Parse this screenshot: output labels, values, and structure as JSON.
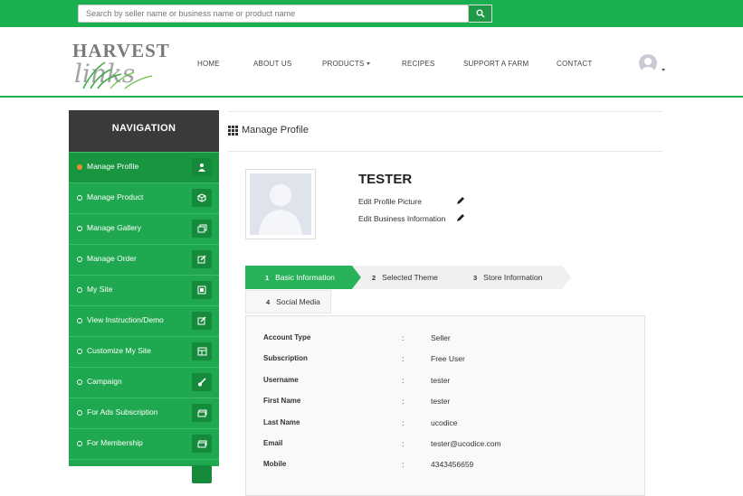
{
  "search": {
    "placeholder": "Search by seller name or business name or product name"
  },
  "logo": {
    "text_line1": "HARVEST",
    "text_line2": "links"
  },
  "nav": {
    "home": "HOME",
    "about": "ABOUT US",
    "products": "PRODUCTS",
    "recipes": "RECIPES",
    "support": "SUPPORT A FARM",
    "contact": "CONTACT"
  },
  "sidebar": {
    "title": "NAVIGATION",
    "items": [
      {
        "label": "Manage Profile",
        "icon": "user-icon",
        "active": true
      },
      {
        "label": "Manage Product",
        "icon": "cube-icon"
      },
      {
        "label": "Manage Gallery",
        "icon": "gallery-icon"
      },
      {
        "label": "Manage Order",
        "icon": "edit-icon"
      },
      {
        "label": "My Site",
        "icon": "site-icon"
      },
      {
        "label": "View Instruction/Demo",
        "icon": "edit-icon"
      },
      {
        "label": "Customize My Site",
        "icon": "layout-icon"
      },
      {
        "label": "Campaign",
        "icon": "brush-icon"
      },
      {
        "label": "For Ads Subscription",
        "icon": "card-icon"
      },
      {
        "label": "For Membership",
        "icon": "card-icon"
      }
    ]
  },
  "page": {
    "title": "Manage Profile"
  },
  "profile": {
    "name": "TESTER",
    "edit_picture": "Edit Profile Picture",
    "edit_business": "Edit Business Information"
  },
  "steps": [
    {
      "num": "1",
      "label": "Basic Information",
      "active": true
    },
    {
      "num": "2",
      "label": "Selected Theme"
    },
    {
      "num": "3",
      "label": "Store Information"
    },
    {
      "num": "4",
      "label": "Social Media"
    }
  ],
  "info": {
    "colon": ":",
    "rows": [
      {
        "label": "Account Type",
        "value": "Seller"
      },
      {
        "label": "Subscription",
        "value": "Free User"
      },
      {
        "label": "Username",
        "value": "tester"
      },
      {
        "label": "First Name",
        "value": "tester"
      },
      {
        "label": "Last Name",
        "value": "ucodice"
      },
      {
        "label": "Email",
        "value": "tester@ucodice.com"
      },
      {
        "label": "Mobile",
        "value": "4343456659"
      }
    ]
  },
  "colors": {
    "green": "#1bb04f",
    "dark_green": "#17963f",
    "header_dark": "#3a3a3a",
    "active_dot": "#f38a2e"
  }
}
